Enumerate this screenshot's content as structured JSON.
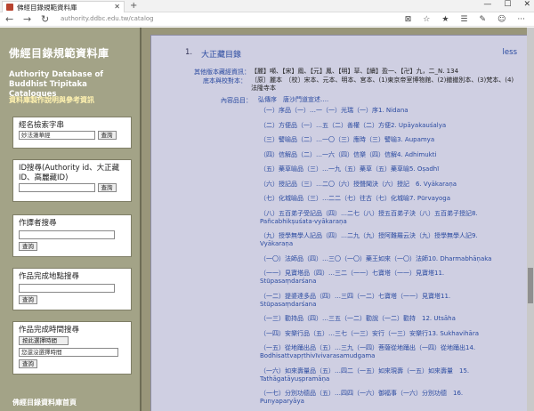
{
  "browser": {
    "tab_title": "佛經目錄規範資料庫",
    "tab_close": "✕",
    "new_tab": "+",
    "window_controls": [
      "—",
      "☐",
      "✕"
    ],
    "address": "authority.ddbc.edu.tw/catalog",
    "back": "←",
    "forward": "→",
    "refresh": "↻",
    "tools": [
      "⊠",
      "☆",
      "★",
      "☰",
      "✎",
      "☺",
      "···"
    ]
  },
  "sidebar": {
    "title": "佛經目錄規範資料庫",
    "en_title": "Authority Database of Buddhist Tripitaka Catalogues",
    "link": "資料庫製作說明與參考資訊",
    "search_title": {
      "label": "經名檢索字串",
      "value": "妙法蓮華經",
      "button": "查詢"
    },
    "search_id": {
      "label": "ID搜尋(Authority id、大正藏ID、高麗藏ID)",
      "value": "",
      "button": "查詢"
    },
    "search_author": {
      "label": "作譯者搜尋",
      "value": "",
      "button": "查詢"
    },
    "search_place": {
      "label": "作品完成地點搜尋",
      "value": "",
      "button": "查詢"
    },
    "search_time": {
      "label": "作品完成時間搜尋",
      "start_button": "按此選擇時間",
      "end_value": "您還沒選擇時間",
      "button": "查詢"
    },
    "footer": "佛經目錄資料庫首頁"
  },
  "main": {
    "item_no": "1.",
    "item_title": "大正藏目錄",
    "less": "less",
    "other_label": "其他版本藏經資訊：",
    "other_value": "【麗】噸、【宋】鳳、【元】鳳、【明】草、【續】盈一、【卍】九，二_N. 134",
    "base_label": "底本與校對本：",
    "base_value": "〔原〕麗本　〔校〕宋本、元本、明本、宮本、(1)東京帝室博物館、(2)撤撤別本、(3)梵本、(4)法隆寺本",
    "content_label": "內容品目：",
    "content_head": "弘傳序　唐沙門道宣述….",
    "entries": [
      [
        "（一）序品（一）…一（一）光瑞（一）序1. Nidana"
      ],
      [
        "（二）方便品（一）…五（二）善權（二）方便2. Upāyakauśalya"
      ],
      [
        "（三）譬喻品（二）…一〇（三）應時（三）譬喻3. Aupamya"
      ],
      [
        "（四）信解品（二）…一六（四）信樂（四）信解4. Adhimukti"
      ],
      [
        "（五）藥草喻品（三）…一九（五）藥草（五）藥草喻5. Oṣadhī"
      ],
      [
        "（六）授記品（三）…二〇（六）授聲聞決（六）授記　6. Vyākaraṇa"
      ],
      [
        "（七）化城喻品（三）…二二（七）往古（七）化城喻7. Pūrvayoga"
      ],
      [
        "（八）五百弟子受記品（四）…二七（八）授五百弟子決（八）五百弟子授記8.",
        "Pañcabhikṣuśata-vyākaraṇa"
      ],
      [
        "（九）授學無學人記品（四）…二九（九）授阿難羅云決（九）授學無學人記9.",
        "Vyākaraṇa"
      ],
      [
        "（一〇）法師品（四）…三〇（一〇）藥王如來（一〇）法師10. Dharmabhāṇaka"
      ],
      [
        "（一一）見寶塔品（四）…三二（一一）七寶塔（一一）見寶塔11.",
        "Stūpasaṃdarśana"
      ],
      [
        "（一二）提婆達多品（四）…三四（一二）七寶塔（一一）見寶塔11.",
        "Stūpasaṃdarśana"
      ],
      [
        "（一三）勸持品（四）…三五（一二）勸說（一二）勸持　12. Utsāha"
      ],
      [
        "（一四）安樂行品（五）…三七（一三）安行（一三）安樂行13. Sukhavihāra"
      ],
      [
        "（一五）從地踊出品（五）…三九（一四）菩薩從地踊出（一四）從地踊出14.",
        "Bodhisattvapṛthivīvivarasamudgama"
      ],
      [
        "（一六）如來壽量品（五）…四二（一五）如來現壽（一五）如來壽量　15.",
        "Tathāgatāyuṣpramāṇa"
      ],
      [
        "（一七）分別功德品（五）…四四（一六）御福事（一六）分別功德　16.",
        "Punyaparyāya"
      ]
    ]
  }
}
